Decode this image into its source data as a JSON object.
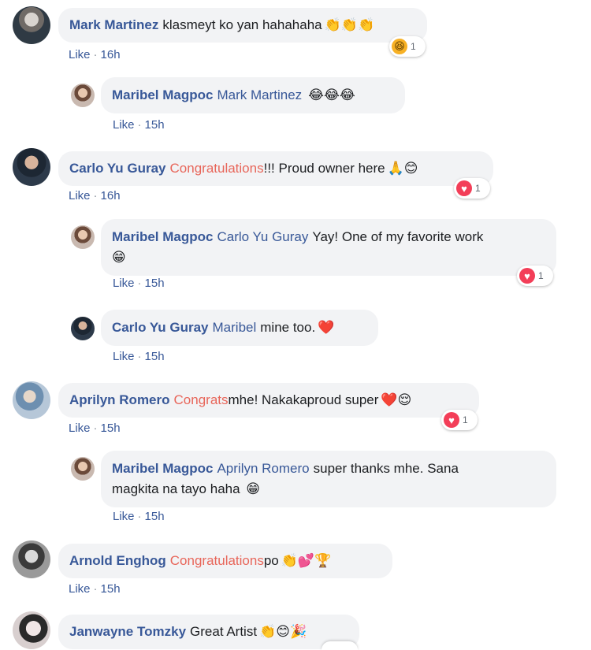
{
  "meta": {
    "like_label": "Like",
    "separator": "·"
  },
  "comments": [
    {
      "author": "Mark Martinez",
      "text": "klasmeyt ko yan hahahaha",
      "emoji": "👏👏👏",
      "time": "16h",
      "reaction": {
        "icon": "haha-reaction-icon",
        "glyph": "😆",
        "count": "1"
      },
      "replies": [
        {
          "author": "Maribel Magpoc",
          "mention": "Mark Martinez",
          "text": "",
          "emoji": "😂😂😂",
          "time": "15h"
        }
      ]
    },
    {
      "author": "Carlo Yu Guray",
      "highlight": "Congratulations",
      "text": "!!! Proud owner here",
      "emoji": "🙏😊",
      "time": "16h",
      "reaction": {
        "icon": "heart-reaction-icon",
        "glyph": "♥",
        "count": "1"
      },
      "replies": [
        {
          "author": "Maribel Magpoc",
          "mention": "Carlo Yu Guray",
          "text": "Yay! One of my favorite work",
          "emoji": "😁",
          "time": "15h",
          "reaction": {
            "icon": "heart-reaction-icon",
            "glyph": "♥",
            "count": "1"
          }
        },
        {
          "author": "Carlo Yu Guray",
          "mention": "Maribel",
          "text": "mine too.",
          "emoji": "❤️",
          "time": "15h"
        }
      ]
    },
    {
      "author": "Aprilyn Romero",
      "highlight": "Congrats",
      "text": "mhe! Nakakaproud super",
      "emoji": "❤️😌",
      "time": "15h",
      "reaction": {
        "icon": "heart-reaction-icon",
        "glyph": "♥",
        "count": "1"
      },
      "replies": [
        {
          "author": "Maribel Magpoc",
          "mention": "Aprilyn Romero",
          "text": "super thanks mhe. Sana",
          "text2": "magkita na tayo haha",
          "emoji": "😁",
          "time": "15h"
        }
      ]
    },
    {
      "author": "Arnold Enghog",
      "highlight": "Congratulations",
      "text": "po",
      "emoji": "👏💕🏆",
      "time": "15h"
    },
    {
      "author": "Janwayne Tomzky",
      "text": "Great Artist",
      "emoji": "👏😊🎉"
    }
  ],
  "colors": {
    "link": "#385898",
    "highlight": "#e8665a",
    "bubble": "#f2f3f5",
    "heart": "#f33e58"
  }
}
